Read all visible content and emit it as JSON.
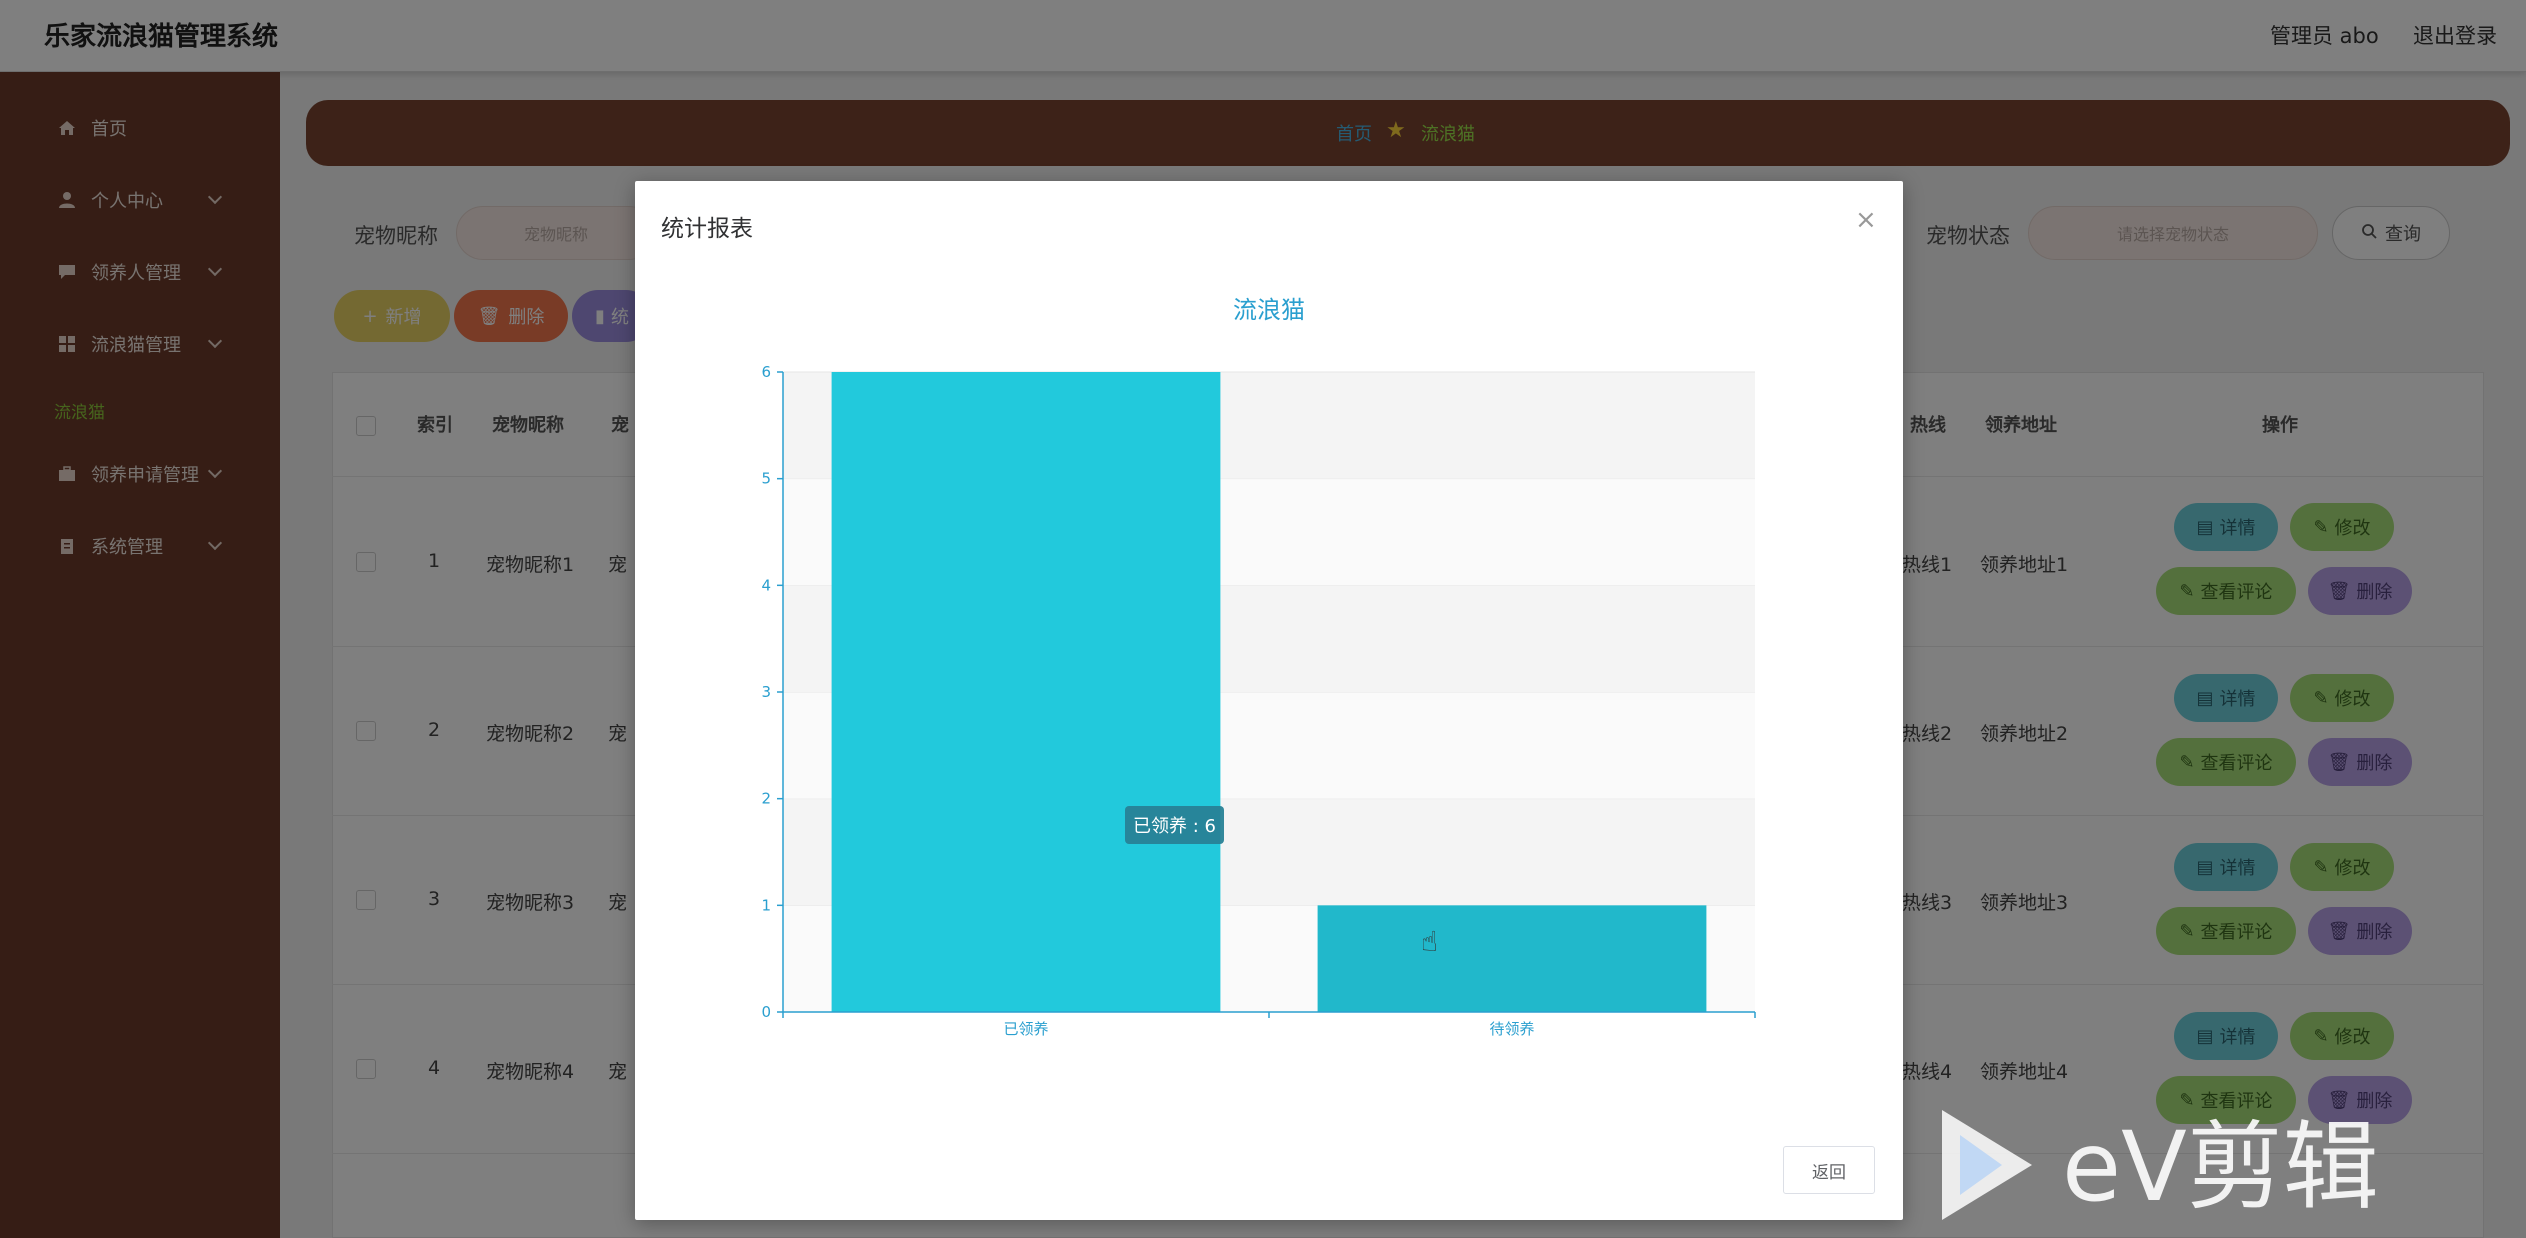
{
  "app": {
    "title": "乐家流浪猫管理系统",
    "admin_label": "管理员 abo",
    "logout": "退出登录"
  },
  "sidebar": {
    "items": [
      {
        "label": "首页",
        "icon": "home-icon",
        "has_chevron": false
      },
      {
        "label": "个人中心",
        "icon": "user-icon",
        "has_chevron": true
      },
      {
        "label": "领养人管理",
        "icon": "chat-icon",
        "has_chevron": true
      },
      {
        "label": "流浪猫管理",
        "icon": "grid-icon",
        "has_chevron": true
      },
      {
        "label": "领养申请管理",
        "icon": "briefcase-icon",
        "has_chevron": true
      },
      {
        "label": "系统管理",
        "icon": "clipboard-icon",
        "has_chevron": true
      }
    ],
    "active_sub": "流浪猫"
  },
  "breadcrumb": {
    "home": "首页",
    "current": "流浪猫"
  },
  "search": {
    "nickname_label": "宠物昵称",
    "nickname_placeholder": "宠物昵称",
    "status_label": "宠物状态",
    "status_placeholder": "请选择宠物状态",
    "query_label": "查询"
  },
  "toolbar": {
    "add_label": "新增",
    "delete_label": "删除",
    "stats_label": "统"
  },
  "table": {
    "headers": {
      "index": "索引",
      "nickname": "宠物昵称",
      "breed": "宠",
      "hotline": "热线",
      "address": "领养地址",
      "actions": "操作"
    },
    "rows": [
      {
        "index": "1",
        "nickname": "宠物昵称1",
        "breed": "宠",
        "hotline": "热线1",
        "address": "领养地址1"
      },
      {
        "index": "2",
        "nickname": "宠物昵称2",
        "breed": "宠",
        "hotline": "热线2",
        "address": "领养地址2"
      },
      {
        "index": "3",
        "nickname": "宠物昵称3",
        "breed": "宠",
        "hotline": "热线3",
        "address": "领养地址3"
      },
      {
        "index": "4",
        "nickname": "宠物昵称4",
        "breed": "宠",
        "hotline": "热线4",
        "address": "领养地址4"
      }
    ],
    "action_labels": {
      "detail": "详情",
      "edit": "修改",
      "comments": "查看评论",
      "delete": "删除"
    }
  },
  "modal": {
    "title": "统计报表",
    "return_label": "返回",
    "tooltip": "已领养 : 6"
  },
  "chart_data": {
    "type": "bar",
    "title": "流浪猫",
    "categories": [
      "已领养",
      "待领养"
    ],
    "values": [
      6,
      1
    ],
    "ylim": [
      0,
      6
    ],
    "yticks": [
      "0",
      "1",
      "2",
      "3",
      "4",
      "5",
      "6"
    ],
    "bar_colors": [
      "#22c9dc",
      "#21b8cb"
    ],
    "axis_color": "#2a9fcf",
    "grid": true
  },
  "watermark": {
    "text": "eV剪辑"
  },
  "colors": {
    "sidebar": "#6d3b2a",
    "accent_green": "#8dc83a",
    "accent_blue": "#4bb7e6"
  }
}
